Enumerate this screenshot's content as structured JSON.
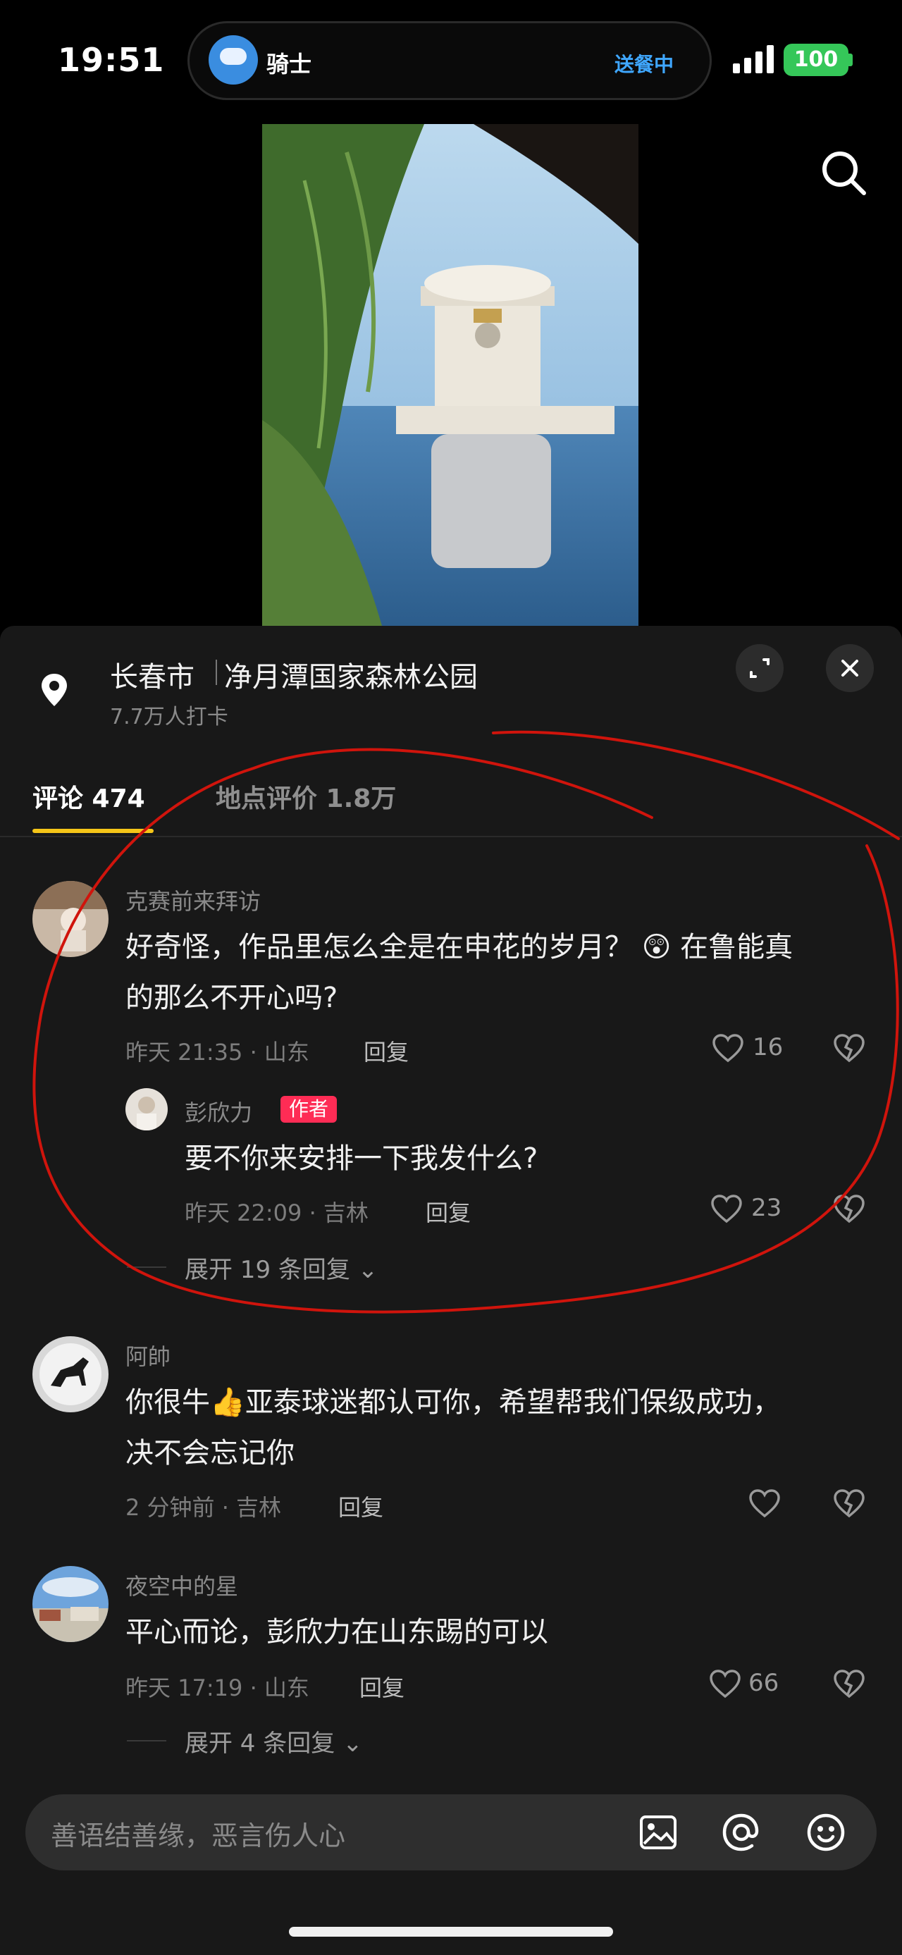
{
  "status_bar": {
    "time": "19:51",
    "island_label": "骑士",
    "island_status": "送餐中",
    "battery": "100"
  },
  "location": {
    "city": "长春市",
    "park": "净月潭国家森林公园",
    "checkins": "7.7万人打卡"
  },
  "tabs": [
    {
      "label": "评论 474",
      "active": true
    },
    {
      "label": "地点评价 1.8万",
      "active": false
    }
  ],
  "comments": [
    {
      "user": "克赛前来拜访",
      "text_line1": "好奇怪，作品里怎么全是在申花的岁月？",
      "text_emoji": "😲",
      "text_line1b": "在鲁能真",
      "text_line2": "的那么不开心吗?",
      "meta": "昨天 21:35 · 山东",
      "reply_label": "回复",
      "likes": "16",
      "reply": {
        "user": "彭欣力",
        "badge": "作者",
        "text": "要不你来安排一下我发什么?",
        "meta": "昨天 22:09 · 吉林",
        "reply_label": "回复",
        "likes": "23"
      },
      "expand_label": "展开 19 条回复"
    },
    {
      "user": "阿帥",
      "text_line1a": "你很牛",
      "text_emoji": "👍",
      "text_line1b": "亚泰球迷都认可你，希望帮我们保级成功，",
      "text_line2": "决不会忘记你",
      "meta": "2 分钟前 · 吉林",
      "reply_label": "回复"
    },
    {
      "user": "夜空中的星",
      "text": "平心而论，彭欣力在山东踢的可以",
      "meta": "昨天 17:19 · 山东",
      "reply_label": "回复",
      "likes": "66",
      "expand_label": "展开 4 条回复"
    }
  ],
  "input": {
    "placeholder": "善语结善缘，恶言伤人心"
  },
  "colors": {
    "accent_tab": "#f5c518",
    "author_badge": "#fe2c55",
    "annotation": "#d0140c"
  }
}
